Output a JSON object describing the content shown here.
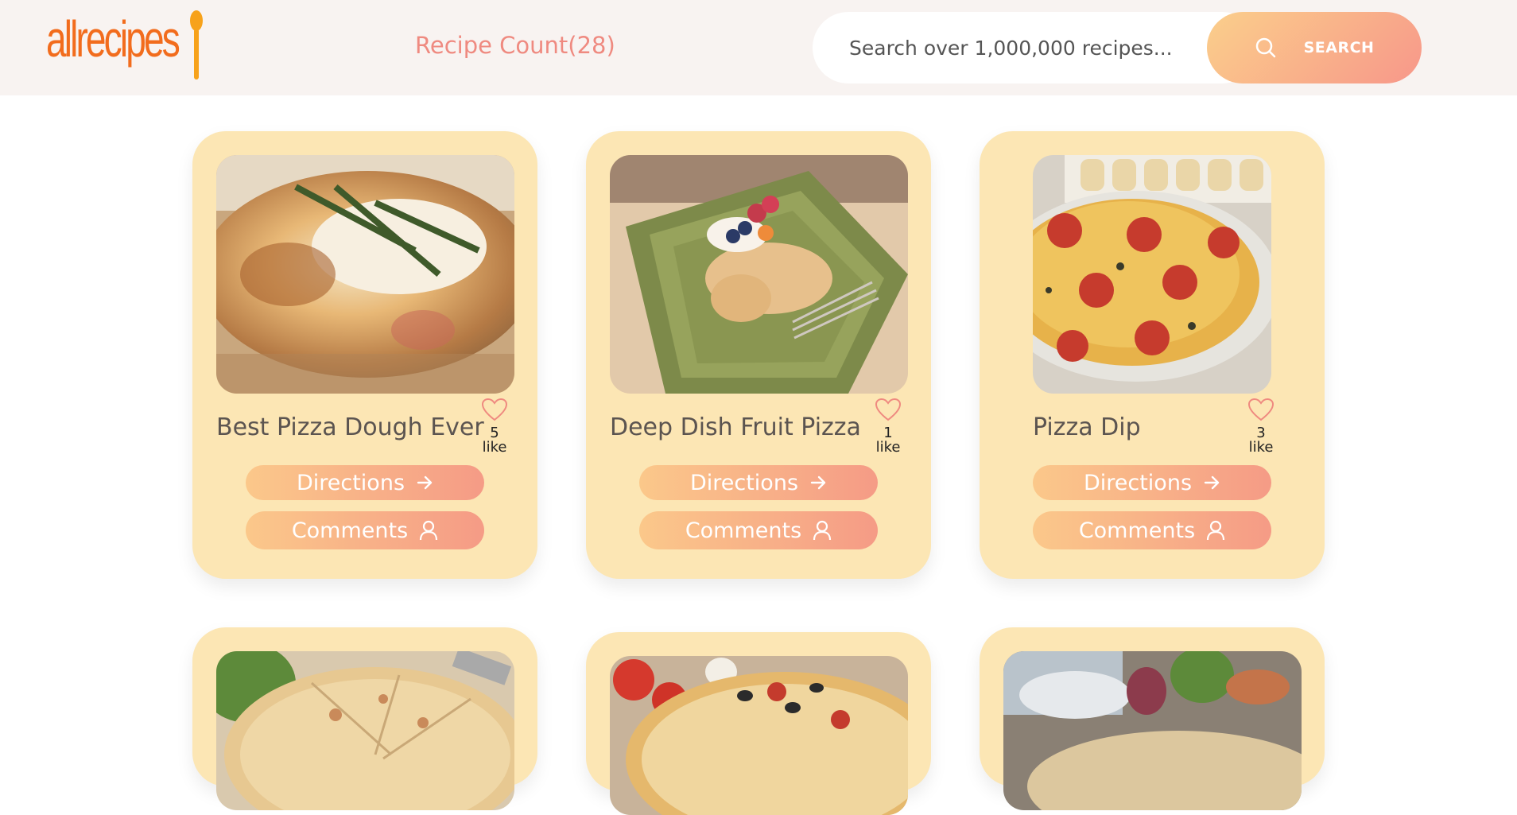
{
  "header": {
    "logo_text": "allrecipes",
    "recipe_count": "Recipe Count(28)",
    "search": {
      "placeholder": "Search over 1,000,000 recipes...",
      "button_label": "SEARCH"
    }
  },
  "recipes": [
    {
      "title": "Best Pizza Dough Ever",
      "likes": "5",
      "like_label": "like",
      "directions_label": "Directions",
      "comments_label": "Comments"
    },
    {
      "title": "Deep Dish Fruit Pizza",
      "likes": "1",
      "like_label": "like",
      "directions_label": "Directions",
      "comments_label": "Comments"
    },
    {
      "title": "Pizza Dip",
      "likes": "3",
      "like_label": "like",
      "directions_label": "Directions",
      "comments_label": "Comments"
    }
  ],
  "colors": {
    "brand_orange": "#f26c1d",
    "accent_pink": "#ef8a80",
    "card_bg": "#fce6b4",
    "gradient_start": "#fbc88a",
    "gradient_end": "#f59b86"
  }
}
